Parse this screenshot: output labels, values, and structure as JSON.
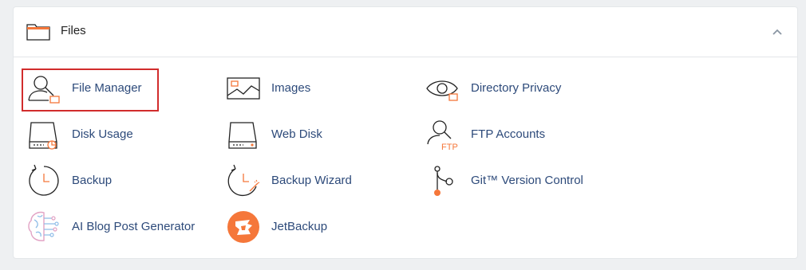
{
  "section": {
    "title": "Files",
    "icons": {
      "header": "folder-icon",
      "collapse": "chevron-up-icon"
    }
  },
  "items": [
    {
      "label": "File Manager",
      "icon": "file-manager-icon"
    },
    {
      "label": "Images",
      "icon": "images-icon"
    },
    {
      "label": "Directory Privacy",
      "icon": "directory-privacy-icon"
    },
    {
      "label": "Disk Usage",
      "icon": "disk-usage-icon"
    },
    {
      "label": "Web Disk",
      "icon": "web-disk-icon"
    },
    {
      "label": "FTP Accounts",
      "icon": "ftp-accounts-icon",
      "badge": "FTP"
    },
    {
      "label": "Backup",
      "icon": "backup-icon"
    },
    {
      "label": "Backup Wizard",
      "icon": "backup-wizard-icon"
    },
    {
      "label": "Git™ Version Control",
      "icon": "git-icon"
    },
    {
      "label": "AI Blog Post Generator",
      "icon": "ai-brain-icon"
    },
    {
      "label": "JetBackup",
      "icon": "jetbackup-icon"
    }
  ],
  "colors": {
    "accent": "#f5773a",
    "link": "#2d4a7a",
    "highlight": "#d12c2c"
  }
}
